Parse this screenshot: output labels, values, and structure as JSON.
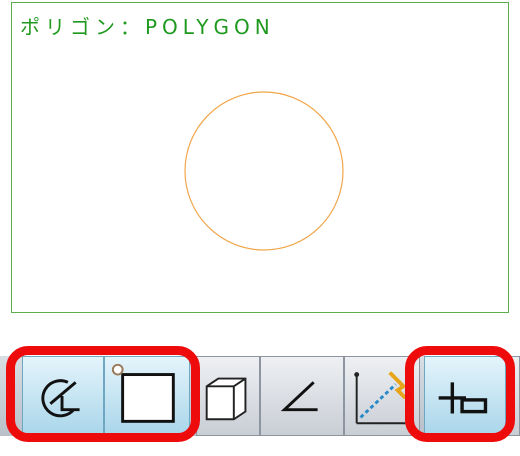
{
  "canvas": {
    "title": "ポリゴン：POLYGON",
    "frame_color": "#5fae4e",
    "title_color": "#1f9a1f",
    "shape_color": "#f0a64a"
  },
  "toolbar": {
    "tools": [
      {
        "name": "inscribed-angle-tool",
        "icon": "angle-arc-icon",
        "active": true
      },
      {
        "name": "square-tool",
        "icon": "square-with-point-icon",
        "active": true
      },
      {
        "name": "box-tool",
        "icon": "3d-box-icon",
        "active": false
      },
      {
        "name": "angle-tool",
        "icon": "angle-icon",
        "active": false
      },
      {
        "name": "axis-dimension-tool",
        "icon": "axis-arrow-icon",
        "active": false
      },
      {
        "name": "move-tool",
        "icon": "plus-rectangle-icon",
        "active": true
      }
    ],
    "highlight_color": "#ee0b0b"
  }
}
